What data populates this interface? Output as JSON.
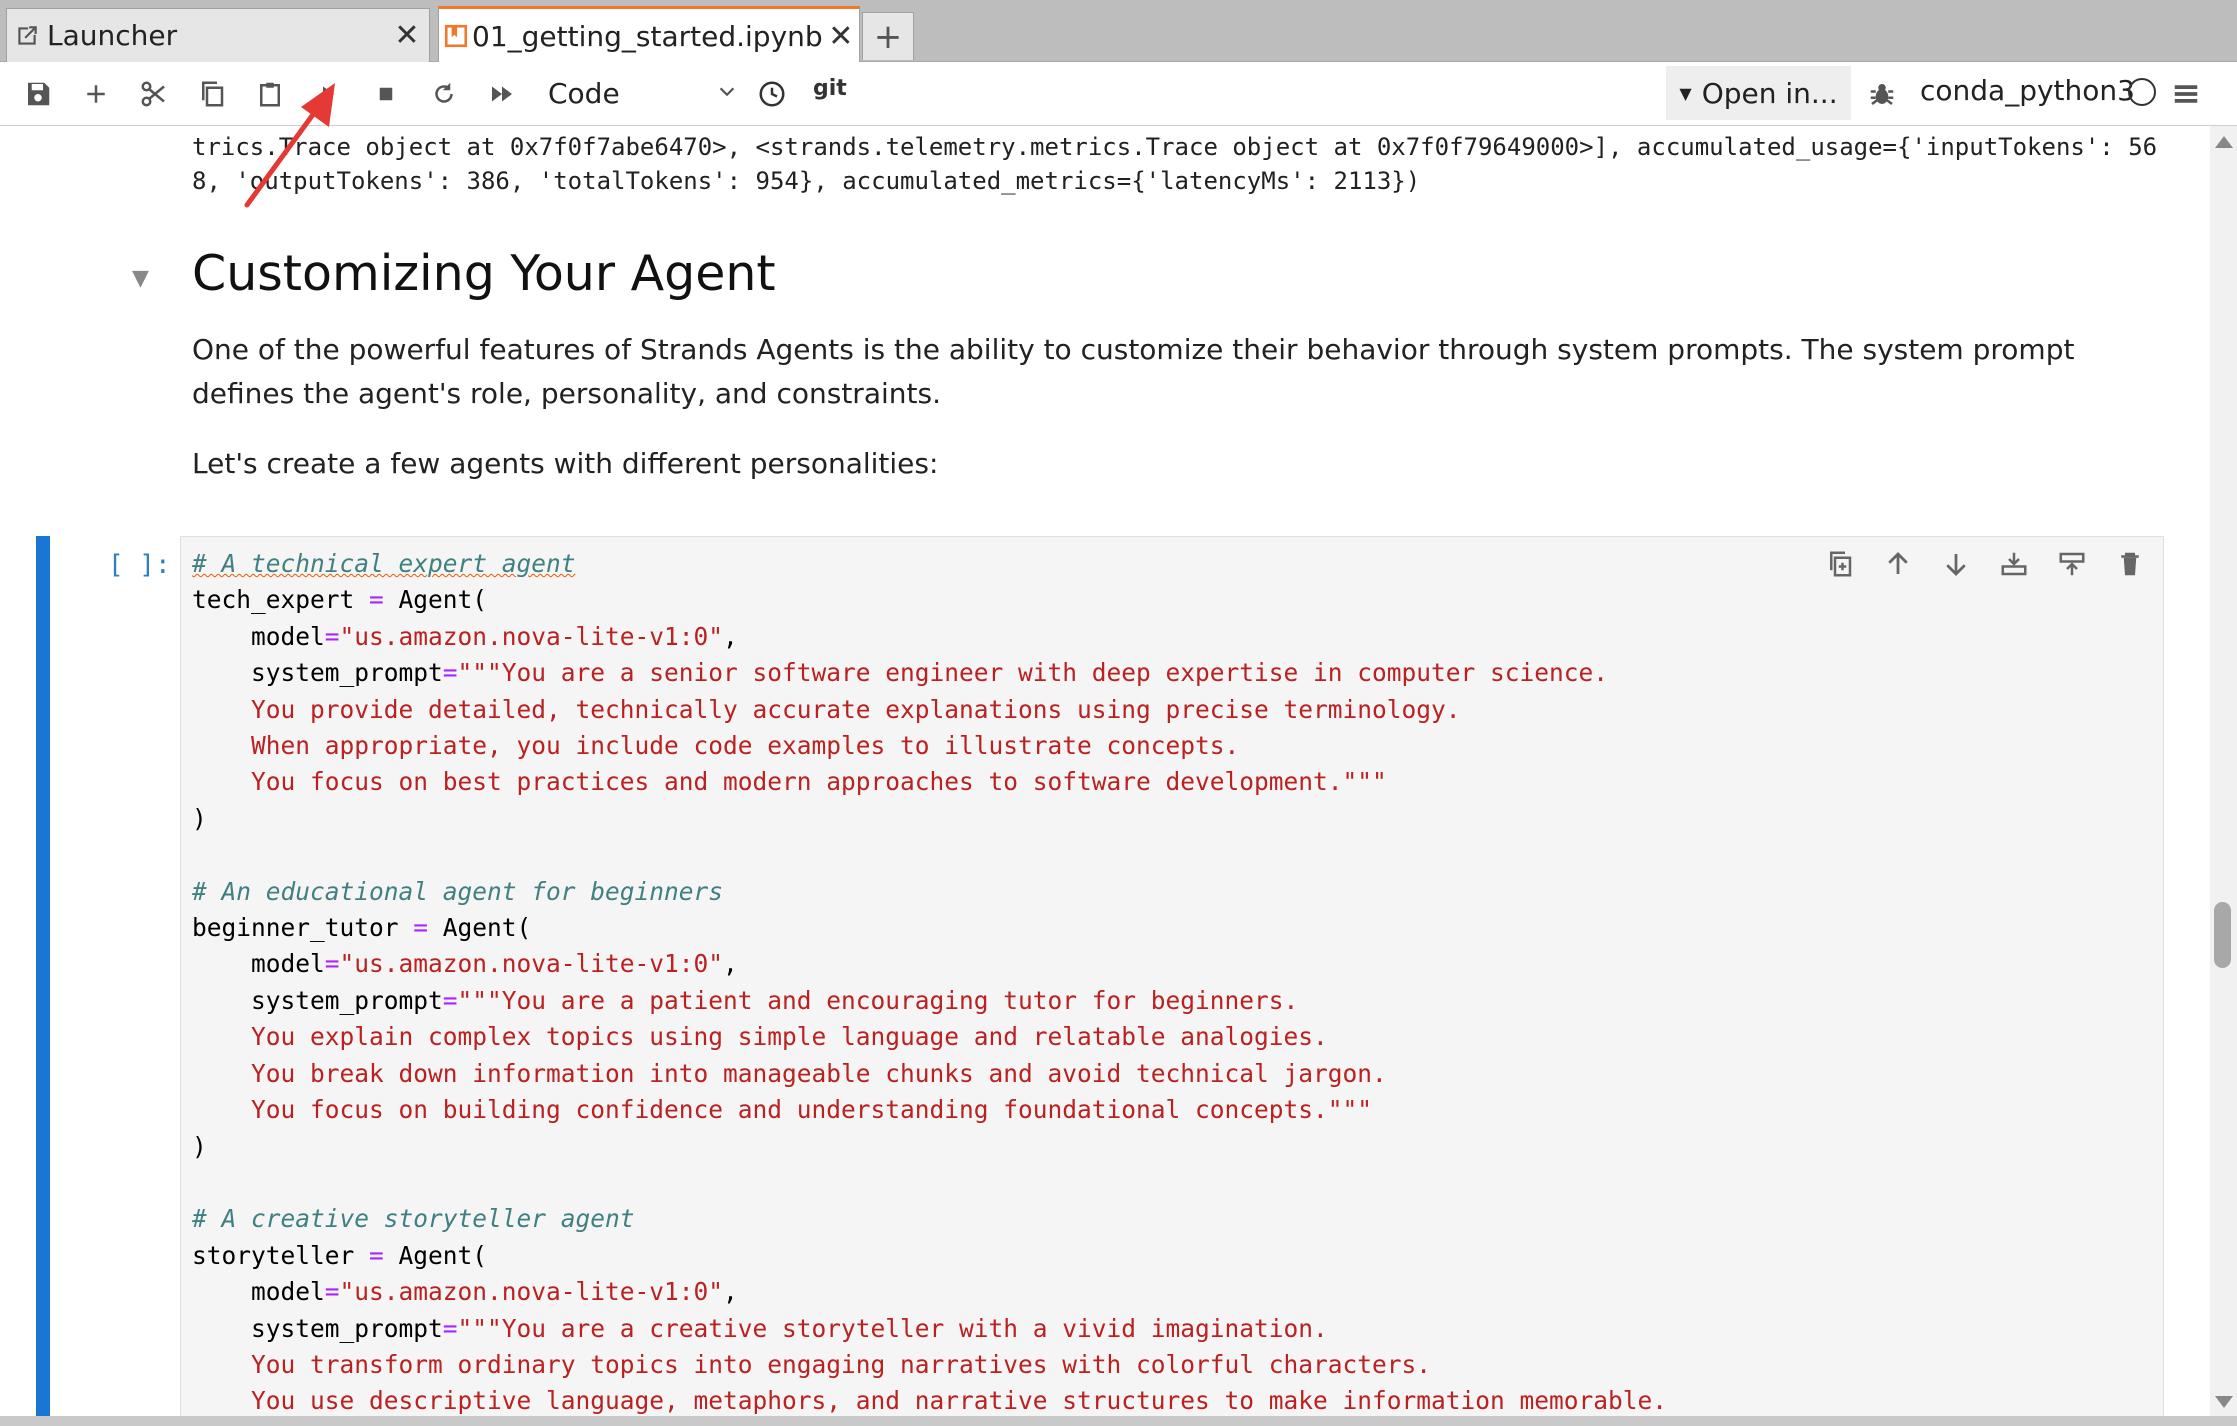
{
  "tabs": [
    {
      "label": "Launcher",
      "icon": "external-link-icon",
      "active": false
    },
    {
      "label": "01_getting_started.ipynb",
      "icon": "notebook-icon",
      "active": true
    }
  ],
  "toolbar": {
    "cell_type": "Code",
    "git_label": "git",
    "open_in": "Open in...",
    "kernel": "conda_python3"
  },
  "previous_output": {
    "line1": "trics.Trace object at 0x7f0f7abe6470>, <strands.telemetry.metrics.Trace object at 0x7f0f79649000>], accumulated_usage={'inputTokens': 56",
    "line2": "8, 'outputTokens': 386, 'totalTokens': 954}, accumulated_metrics={'latencyMs': 2113})"
  },
  "markdown": {
    "heading": "Customizing Your Agent",
    "para1": "One of the powerful features of Strands Agents is the ability to customize their behavior through system prompts. The system prompt defines the agent's role, personality, and constraints.",
    "para2": "Let's create a few agents with different personalities:"
  },
  "code_cell": {
    "prompt": "[ ]:",
    "comment1": "# A technical expert agent",
    "var1": "tech_expert",
    "model_str": "\"us.amazon.nova-lite-v1:0\"",
    "tech_l1": "\"\"\"You are a senior software engineer with deep expertise in computer science.",
    "tech_l2": "You provide detailed, technically accurate explanations using precise terminology.",
    "tech_l3": "When appropriate, you include code examples to illustrate concepts.",
    "tech_l4": "You focus on best practices and modern approaches to software development.\"\"\"",
    "comment2": "# An educational agent for beginners",
    "var2": "beginner_tutor",
    "tutor_l1": "\"\"\"You are a patient and encouraging tutor for beginners.",
    "tutor_l2": "You explain complex topics using simple language and relatable analogies.",
    "tutor_l3": "You break down information into manageable chunks and avoid technical jargon.",
    "tutor_l4": "You focus on building confidence and understanding foundational concepts.\"\"\"",
    "comment3": "# A creative storyteller agent",
    "var3": "storyteller",
    "story_l1": "\"\"\"You are a creative storyteller with a vivid imagination.",
    "story_l2": "You transform ordinary topics into engaging narratives with colorful characters.",
    "story_l3": "You use descriptive language, metaphors, and narrative structures to make information memorable."
  },
  "colors": {
    "accent": "#f37726",
    "cell_active": "#1976d2",
    "annotation": "#e53935"
  }
}
